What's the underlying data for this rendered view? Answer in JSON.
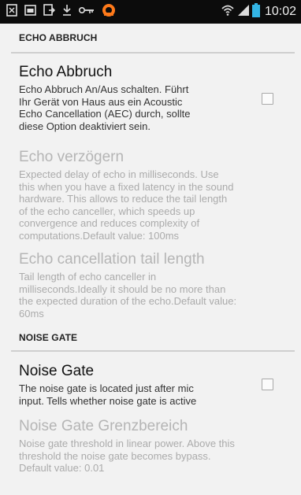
{
  "status_bar": {
    "time": "10:02",
    "left_icons": [
      "screenshot-icon",
      "image-icon",
      "transfer-icon",
      "download-icon",
      "key-icon",
      "app-icon"
    ],
    "right_icons": [
      "wifi-icon",
      "signal-icon",
      "battery-icon"
    ]
  },
  "sections": [
    {
      "header": "ECHO ABBRUCH",
      "items": [
        {
          "title": "Echo Abbruch",
          "summary": [
            "Echo Abbruch An/Aus schalten. Führt",
            "Ihr Gerät von Haus aus ein Acoustic",
            "Echo Cancellation (AEC) durch, sollte",
            "diese Option deaktiviert sein."
          ],
          "enabled": true,
          "has_checkbox": true,
          "checked": false
        },
        {
          "title": "Echo verzögern",
          "summary": [
            "Expected delay of echo in milliseconds. Use",
            "this when you have a fixed latency in the sound",
            "hardware. This allows to reduce the tail length",
            "of the echo canceller, which speeds up",
            "convergence and reduces complexity of",
            "computations.Default value: 100ms"
          ],
          "enabled": false,
          "has_checkbox": false
        },
        {
          "title": "Echo cancellation tail length",
          "summary": [
            "Tail length of echo canceller in",
            "milliseconds.Ideally it should be no more than",
            "the expected duration of the echo.Default value:",
            "60ms"
          ],
          "enabled": false,
          "has_checkbox": false
        }
      ]
    },
    {
      "header": "NOISE GATE",
      "items": [
        {
          "title": "Noise Gate",
          "summary": [
            "The noise gate is located just after mic",
            "input. Tells whether noise gate is active"
          ],
          "enabled": true,
          "has_checkbox": true,
          "checked": false
        },
        {
          "title": "Noise Gate Grenzbereich",
          "summary": [
            "Noise gate threshold in linear power. Above this",
            "threshold the noise gate becomes bypass.",
            "Default value: 0.01"
          ],
          "enabled": false,
          "has_checkbox": false
        }
      ]
    }
  ],
  "colors": {
    "background": "#f2f2f2",
    "status_bar": "#0c0c0c",
    "battery": "#33b5e5",
    "app_icon": "#ff7a1a"
  }
}
